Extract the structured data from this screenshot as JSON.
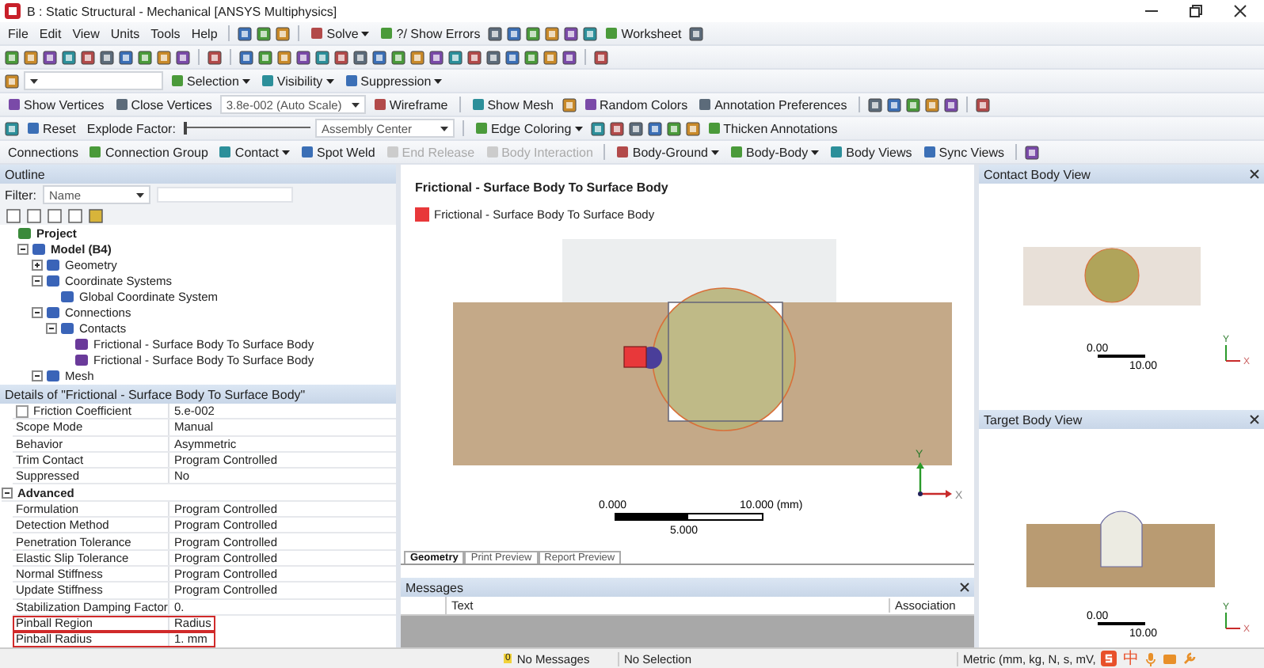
{
  "window": {
    "title": "B : Static Structural - Mechanical [ANSYS Multiphysics]"
  },
  "toolbar_rows": [
    {
      "items": [
        {
          "kind": "menu",
          "label": "File"
        },
        {
          "kind": "menu",
          "label": "Edit"
        },
        {
          "kind": "menu",
          "label": "View"
        },
        {
          "kind": "menu",
          "label": "Units"
        },
        {
          "kind": "menu",
          "label": "Tools"
        },
        {
          "kind": "menu",
          "label": "Help"
        },
        {
          "kind": "separator"
        },
        {
          "kind": "icon"
        },
        {
          "kind": "icon"
        },
        {
          "kind": "icon"
        },
        {
          "kind": "separator"
        },
        {
          "kind": "dropdown",
          "label": "Solve",
          "disabled": false
        },
        {
          "kind": "button",
          "label": "?/ Show Errors",
          "disabled": false
        },
        {
          "kind": "icon"
        },
        {
          "kind": "icon"
        },
        {
          "kind": "icon"
        },
        {
          "kind": "icon"
        },
        {
          "kind": "icon"
        },
        {
          "kind": "icon"
        },
        {
          "kind": "button",
          "label": "Worksheet",
          "disabled": false
        },
        {
          "kind": "icon"
        }
      ]
    },
    {
      "items": [
        {
          "kind": "icon"
        },
        {
          "kind": "icon"
        },
        {
          "kind": "icon"
        },
        {
          "kind": "icon"
        },
        {
          "kind": "icon"
        },
        {
          "kind": "icon"
        },
        {
          "kind": "icon"
        },
        {
          "kind": "icon"
        },
        {
          "kind": "icon"
        },
        {
          "kind": "icon"
        },
        {
          "kind": "separator"
        },
        {
          "kind": "icon"
        },
        {
          "kind": "separator"
        },
        {
          "kind": "icon"
        },
        {
          "kind": "icon"
        },
        {
          "kind": "icon"
        },
        {
          "kind": "icon"
        },
        {
          "kind": "icon"
        },
        {
          "kind": "icon"
        },
        {
          "kind": "icon"
        },
        {
          "kind": "icon"
        },
        {
          "kind": "icon"
        },
        {
          "kind": "icon"
        },
        {
          "kind": "icon"
        },
        {
          "kind": "icon"
        },
        {
          "kind": "icon"
        },
        {
          "kind": "icon"
        },
        {
          "kind": "icon"
        },
        {
          "kind": "icon"
        },
        {
          "kind": "icon"
        },
        {
          "kind": "icon"
        },
        {
          "kind": "separator"
        },
        {
          "kind": "icon"
        }
      ]
    },
    {
      "items": [
        {
          "kind": "icon"
        },
        {
          "kind": "combo"
        },
        {
          "kind": "dropdown",
          "label": "Selection",
          "disabled": false
        },
        {
          "kind": "dropdown",
          "label": "Visibility",
          "disabled": false
        },
        {
          "kind": "dropdown",
          "label": "Suppression",
          "disabled": false
        }
      ]
    },
    {
      "items": [
        {
          "kind": "button",
          "label": "Show Vertices",
          "disabled": false
        },
        {
          "kind": "button",
          "label": "Close Vertices",
          "disabled": false
        },
        {
          "kind": "combo",
          "label": "3.8e-002 (Auto Scale)"
        },
        {
          "kind": "button",
          "label": "Wireframe",
          "disabled": false
        },
        {
          "kind": "separator"
        },
        {
          "kind": "button",
          "label": "Show Mesh",
          "disabled": false
        },
        {
          "kind": "icon"
        },
        {
          "kind": "button",
          "label": "Random Colors",
          "disabled": false
        },
        {
          "kind": "button",
          "label": "Annotation Preferences",
          "disabled": false
        },
        {
          "kind": "separator"
        },
        {
          "kind": "icon"
        },
        {
          "kind": "icon"
        },
        {
          "kind": "icon"
        },
        {
          "kind": "icon"
        },
        {
          "kind": "icon"
        },
        {
          "kind": "separator"
        },
        {
          "kind": "icon"
        }
      ]
    },
    {
      "items": [
        {
          "kind": "icon"
        },
        {
          "kind": "button",
          "label": "Reset",
          "disabled": false
        },
        {
          "kind": "label",
          "label": "Explode Factor:"
        },
        {
          "kind": "slider",
          "level": 0
        },
        {
          "kind": "combo",
          "label": "Assembly Center"
        },
        {
          "kind": "separator"
        },
        {
          "kind": "dropdown",
          "label": "Edge Coloring",
          "disabled": false
        },
        {
          "kind": "icon"
        },
        {
          "kind": "icon"
        },
        {
          "kind": "icon"
        },
        {
          "kind": "icon"
        },
        {
          "kind": "icon"
        },
        {
          "kind": "icon"
        },
        {
          "kind": "button",
          "label": "Thicken Annotations",
          "disabled": false
        }
      ]
    },
    {
      "items": [
        {
          "kind": "label",
          "label": "Connections"
        },
        {
          "kind": "button",
          "label": "Connection Group",
          "disabled": false
        },
        {
          "kind": "dropdown",
          "label": "Contact",
          "disabled": false
        },
        {
          "kind": "button",
          "label": "Spot Weld",
          "disabled": false
        },
        {
          "kind": "button",
          "label": "End Release",
          "disabled": true
        },
        {
          "kind": "button",
          "label": "Body Interaction",
          "disabled": true
        },
        {
          "kind": "separator"
        },
        {
          "kind": "dropdown",
          "label": "Body-Ground",
          "disabled": false
        },
        {
          "kind": "dropdown",
          "label": "Body-Body",
          "disabled": false
        },
        {
          "kind": "button",
          "label": "Body Views",
          "disabled": false
        },
        {
          "kind": "button",
          "label": "Sync Views",
          "disabled": false
        },
        {
          "kind": "separator"
        },
        {
          "kind": "icon"
        }
      ]
    }
  ],
  "outline": {
    "title": "Outline",
    "filter_label": "Filter:",
    "filter_value": "Name",
    "tree": [
      {
        "label": "Project",
        "children": [
          {
            "label": "Model (B4)",
            "expanded": true,
            "children": [
              {
                "label": "Geometry",
                "expanded": false
              },
              {
                "label": "Coordinate Systems",
                "expanded": true,
                "children": [
                  {
                    "label": "Global Coordinate System"
                  }
                ]
              },
              {
                "label": "Connections",
                "expanded": true,
                "children": [
                  {
                    "label": "Contacts",
                    "expanded": true,
                    "children": [
                      {
                        "label": "Frictional - Surface Body To Surface Body",
                        "selected": false
                      },
                      {
                        "label": "Frictional - Surface Body To Surface Body",
                        "selected": false
                      }
                    ]
                  }
                ]
              },
              {
                "label": "Mesh",
                "expanded": true
              }
            ]
          }
        ]
      }
    ]
  },
  "details": {
    "title": "Details of \"Frictional - Surface Body To Surface Body\"",
    "rows": [
      {
        "kind": "property",
        "name": "Friction Coefficient",
        "value": "5.e-002",
        "checked": false,
        "highlighted": false
      },
      {
        "kind": "property",
        "name": "Scope Mode",
        "value": "Manual",
        "highlighted": false
      },
      {
        "kind": "property",
        "name": "Behavior",
        "value": "Asymmetric",
        "highlighted": false
      },
      {
        "kind": "property",
        "name": "Trim Contact",
        "value": "Program Controlled",
        "highlighted": false
      },
      {
        "kind": "property",
        "name": "Suppressed",
        "value": "No",
        "highlighted": false
      },
      {
        "kind": "section",
        "name": "Advanced",
        "expanded": true,
        "highlighted": false
      },
      {
        "kind": "property",
        "name": "Formulation",
        "value": "Program Controlled",
        "highlighted": false
      },
      {
        "kind": "property",
        "name": "Detection Method",
        "value": "Program Controlled",
        "highlighted": false
      },
      {
        "kind": "property",
        "name": "Penetration Tolerance",
        "value": "Program Controlled",
        "highlighted": false
      },
      {
        "kind": "property",
        "name": "Elastic Slip Tolerance",
        "value": "Program Controlled",
        "highlighted": false
      },
      {
        "kind": "property",
        "name": "Normal Stiffness",
        "value": "Program Controlled",
        "highlighted": false
      },
      {
        "kind": "property",
        "name": "Update Stiffness",
        "value": "Program Controlled",
        "highlighted": false
      },
      {
        "kind": "property",
        "name": "Stabilization Damping Factor",
        "value": "0.",
        "highlighted": false
      },
      {
        "kind": "property",
        "name": "Pinball Region",
        "value": "Radius",
        "highlighted": true
      },
      {
        "kind": "property",
        "name": "Pinball Radius",
        "value": "1. mm",
        "highlighted": true
      }
    ]
  },
  "graphics": {
    "title": "Frictional - Surface Body To Surface Body",
    "legend": [
      {
        "label": "Frictional - Surface Body To Surface Body",
        "color": "#e8383a"
      }
    ],
    "scale": {
      "start": "0.000",
      "end": "10.000 (mm)",
      "mid": "5.000"
    },
    "axes": {
      "y": "Y",
      "x": "X"
    },
    "tabs": [
      {
        "label": "Geometry",
        "selected": true
      },
      {
        "label": "Print Preview",
        "selected": false
      },
      {
        "label": "Report Preview",
        "selected": false
      }
    ]
  },
  "messages": {
    "title": "Messages",
    "columns": [
      "Text",
      "Association"
    ]
  },
  "contact_view": {
    "title": "Contact Body View",
    "scale_start": "0.00",
    "scale_end": "10.00",
    "axis_y": "Y",
    "axis_x": "X"
  },
  "target_view": {
    "title": "Target Body View",
    "scale_start": "0.00",
    "scale_end": "10.00",
    "axis_y": "Y",
    "axis_x": "X"
  },
  "status_bar": {
    "messages": "No Messages",
    "messages_count": "0",
    "selection": "No Selection",
    "units": "Metric (mm, kg, N, s, mV,",
    "ime_label": "中"
  }
}
